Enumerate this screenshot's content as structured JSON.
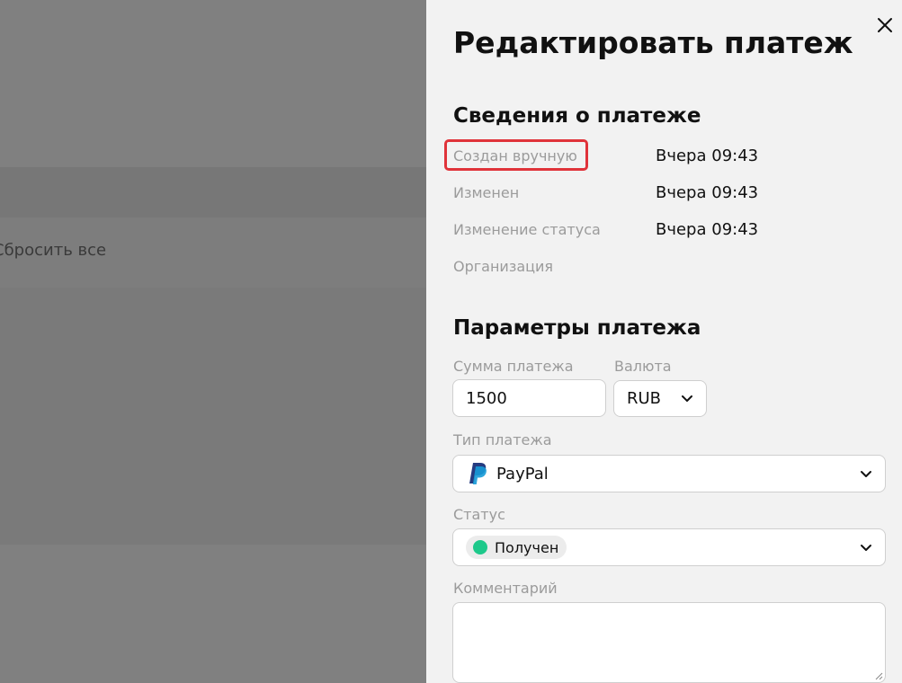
{
  "background": {
    "row_text": "Сбросить все"
  },
  "drawer": {
    "title": "Редактировать платеж",
    "close_icon": "close-icon",
    "details": {
      "heading": "Сведения о платеже",
      "rows": [
        {
          "label": "Создан вручную",
          "value": "Вчера 09:43"
        },
        {
          "label": "Изменен",
          "value": "Вчера 09:43"
        },
        {
          "label": "Изменение статуса",
          "value": "Вчера 09:43"
        },
        {
          "label": "Организация",
          "value": ""
        }
      ],
      "highlight_color": "#e0333a"
    },
    "params": {
      "heading": "Параметры платежа",
      "amount_label": "Сумма платежа",
      "amount_value": "1500",
      "currency_label": "Валюта",
      "currency_value": "RUB",
      "type_label": "Тип платежа",
      "type_value": "PayPal",
      "type_icon": "paypal-icon",
      "status_label": "Статус",
      "status_value": "Получен",
      "status_color": "#1ec98b",
      "comment_label": "Комментарий",
      "comment_value": ""
    }
  }
}
